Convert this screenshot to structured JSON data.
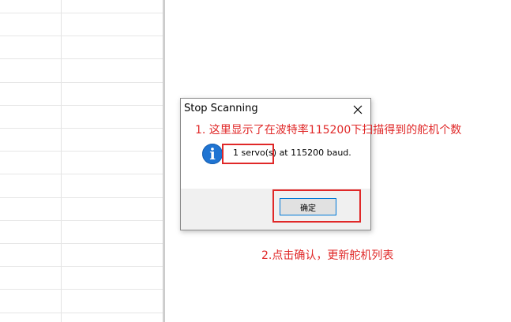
{
  "dialog": {
    "title": "Stop Scanning",
    "message": "1 servo(s) at 115200 baud.",
    "ok_label": "确定"
  },
  "annotations": {
    "note1": "1. 这里显示了在波特率115200下扫描得到的舵机个数",
    "note2": "2.点击确认，更新舵机列表",
    "color": "#e02828"
  },
  "icons": {
    "close": "close-icon",
    "info": "info-icon"
  }
}
